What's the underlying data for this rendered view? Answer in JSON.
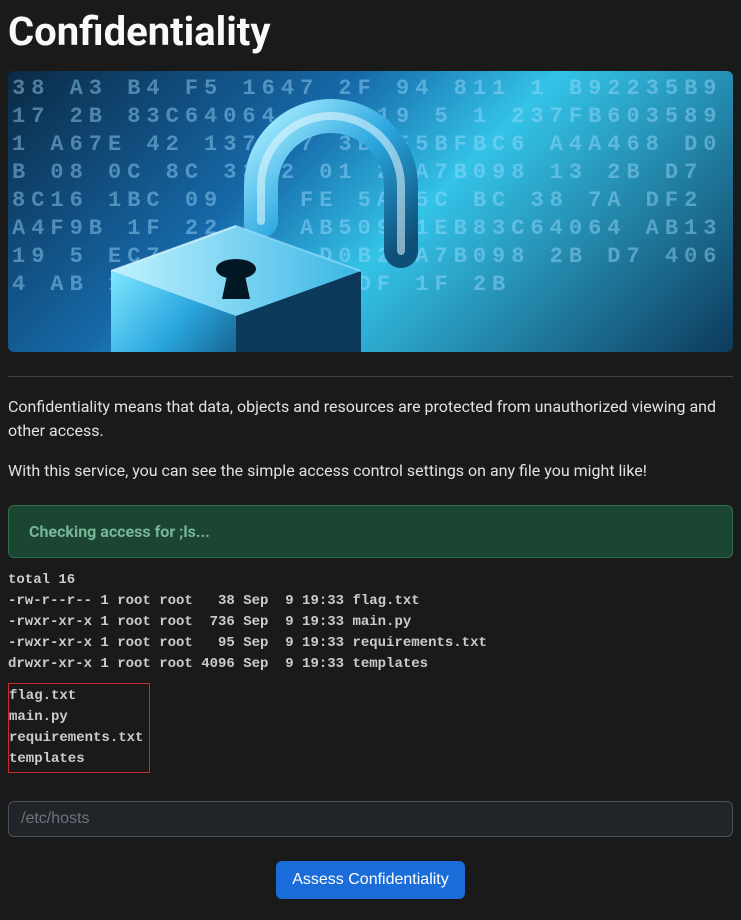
{
  "page": {
    "title": "Confidentiality",
    "intro_1": "Confidentiality means that data, objects and resources are protected from unauthorized viewing and other access.",
    "intro_2": "With this service, you can see the simple access control settings on any file you might like!"
  },
  "alert": {
    "text": "Checking access for ;ls..."
  },
  "output": {
    "listing": "total 16\n-rw-r--r-- 1 root root   38 Sep  9 19:33 flag.txt\n-rwxr-xr-x 1 root root  736 Sep  9 19:33 main.py\n-rwxr-xr-x 1 root root   95 Sep  9 19:33 requirements.txt\ndrwxr-xr-x 1 root root 4096 Sep  9 19:33 templates",
    "short": "flag.txt\nmain.py\nrequirements.txt\ntemplates"
  },
  "form": {
    "placeholder": "/etc/hosts",
    "submit_label": "Assess Confidentiality"
  },
  "hero": {
    "digits": "38 A3 B4 F5 1647 2F 94 811 1 B92235B917 2B 83C64064 AB1319 5 1 237FB6035891 A67E 42 1376C7 3BCF5BFBC6 A4A468 D0B 08 0C 8C 3342 01 27A7B098 13 2B D7 8C16 1BC 09 11 FE 5A 5C BC 38 7A DF2 A4F9B 1F 22 B0 AB50981EB83C64064 AB1319 5 EC7 3A4468 D0B27A7B098 2B D7 4064 AB 1319 FE12 5A DF 1F 2B"
  }
}
